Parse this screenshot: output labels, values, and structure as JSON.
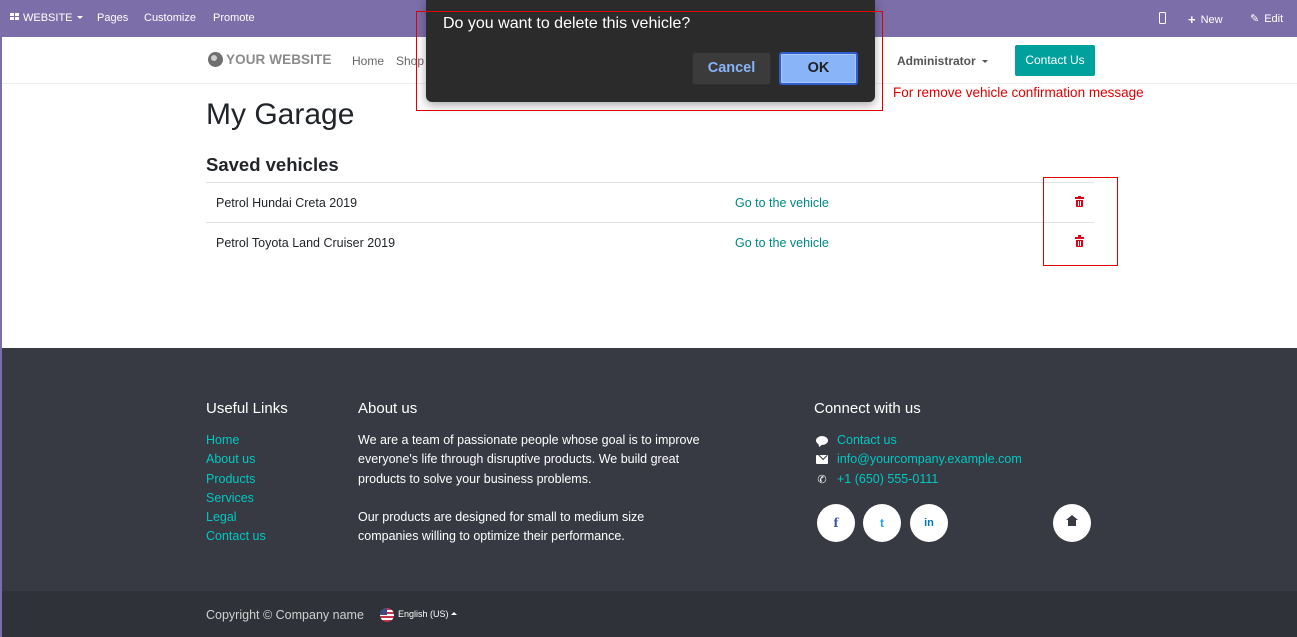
{
  "admin_bar": {
    "app_menu": "WEBSITE",
    "pages": "Pages",
    "customize": "Customize",
    "promote": "Promote",
    "new_label": "New",
    "edit_label": "Edit",
    "color": "#7b6ea9"
  },
  "header": {
    "logo": "YOUR WEBSITE",
    "nav": [
      "Home",
      "Shop"
    ],
    "user_menu": "Administrator",
    "contact_button": "Contact Us",
    "accent": "#00a09d"
  },
  "dialog": {
    "message": "Do you want to delete this vehicle?",
    "cancel": "Cancel",
    "ok": "OK"
  },
  "annotation": {
    "text": "For remove vehicle confirmation message",
    "color": "#e00000"
  },
  "main": {
    "title": "My Garage",
    "section_title": "Saved vehicles",
    "vehicles": [
      {
        "name": "Petrol Hundai Creta 2019",
        "link": "Go to the vehicle",
        "action_icon": "trash-icon"
      },
      {
        "name": "Petrol Toyota Land Cruiser 2019",
        "link": "Go to the vehicle",
        "action_icon": "trash-icon"
      }
    ]
  },
  "footer": {
    "useful_links_title": "Useful Links",
    "useful_links": [
      "Home",
      "About us",
      "Products",
      "Services",
      "Legal",
      "Contact us"
    ],
    "about_title": "About us",
    "about_lines": [
      "We are a team of passionate people whose goal is to improve",
      "everyone's life through disruptive products. We build great",
      "products to solve your business problems.",
      "Our products are designed for small to medium size",
      "companies willing to optimize their performance."
    ],
    "connect_title": "Connect with us",
    "contact": {
      "link": "Contact us",
      "email": "info@yourcompany.example.com",
      "phone": "+1 (650) 555-0111"
    },
    "social": [
      {
        "icon": "facebook-icon",
        "glyph": "f",
        "color": "#3b5998"
      },
      {
        "icon": "twitter-icon",
        "glyph": "t",
        "color": "#1da1f2"
      },
      {
        "icon": "linkedin-icon",
        "glyph": "in",
        "color": "#0077b5"
      }
    ],
    "copyright": "Copyright © Company name",
    "language": "English (US)"
  }
}
